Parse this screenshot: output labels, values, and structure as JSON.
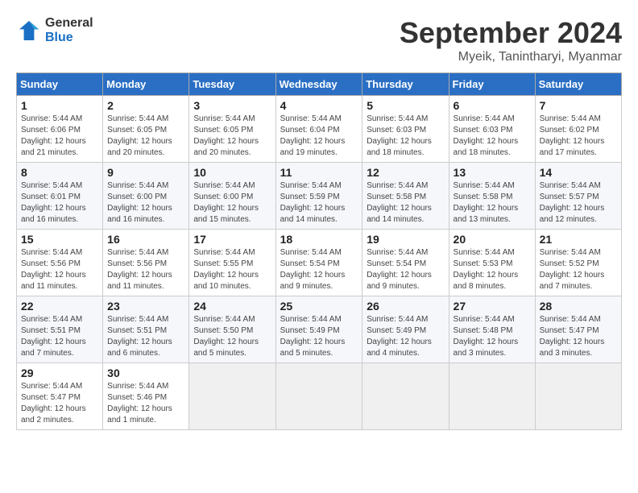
{
  "logo": {
    "line1": "General",
    "line2": "Blue"
  },
  "title": "September 2024",
  "location": "Myeik, Tanintharyi, Myanmar",
  "headers": [
    "Sunday",
    "Monday",
    "Tuesday",
    "Wednesday",
    "Thursday",
    "Friday",
    "Saturday"
  ],
  "weeks": [
    [
      {
        "day": "1",
        "info": "Sunrise: 5:44 AM\nSunset: 6:06 PM\nDaylight: 12 hours\nand 21 minutes."
      },
      {
        "day": "2",
        "info": "Sunrise: 5:44 AM\nSunset: 6:05 PM\nDaylight: 12 hours\nand 20 minutes."
      },
      {
        "day": "3",
        "info": "Sunrise: 5:44 AM\nSunset: 6:05 PM\nDaylight: 12 hours\nand 20 minutes."
      },
      {
        "day": "4",
        "info": "Sunrise: 5:44 AM\nSunset: 6:04 PM\nDaylight: 12 hours\nand 19 minutes."
      },
      {
        "day": "5",
        "info": "Sunrise: 5:44 AM\nSunset: 6:03 PM\nDaylight: 12 hours\nand 18 minutes."
      },
      {
        "day": "6",
        "info": "Sunrise: 5:44 AM\nSunset: 6:03 PM\nDaylight: 12 hours\nand 18 minutes."
      },
      {
        "day": "7",
        "info": "Sunrise: 5:44 AM\nSunset: 6:02 PM\nDaylight: 12 hours\nand 17 minutes."
      }
    ],
    [
      {
        "day": "8",
        "info": "Sunrise: 5:44 AM\nSunset: 6:01 PM\nDaylight: 12 hours\nand 16 minutes."
      },
      {
        "day": "9",
        "info": "Sunrise: 5:44 AM\nSunset: 6:00 PM\nDaylight: 12 hours\nand 16 minutes."
      },
      {
        "day": "10",
        "info": "Sunrise: 5:44 AM\nSunset: 6:00 PM\nDaylight: 12 hours\nand 15 minutes."
      },
      {
        "day": "11",
        "info": "Sunrise: 5:44 AM\nSunset: 5:59 PM\nDaylight: 12 hours\nand 14 minutes."
      },
      {
        "day": "12",
        "info": "Sunrise: 5:44 AM\nSunset: 5:58 PM\nDaylight: 12 hours\nand 14 minutes."
      },
      {
        "day": "13",
        "info": "Sunrise: 5:44 AM\nSunset: 5:58 PM\nDaylight: 12 hours\nand 13 minutes."
      },
      {
        "day": "14",
        "info": "Sunrise: 5:44 AM\nSunset: 5:57 PM\nDaylight: 12 hours\nand 12 minutes."
      }
    ],
    [
      {
        "day": "15",
        "info": "Sunrise: 5:44 AM\nSunset: 5:56 PM\nDaylight: 12 hours\nand 11 minutes."
      },
      {
        "day": "16",
        "info": "Sunrise: 5:44 AM\nSunset: 5:56 PM\nDaylight: 12 hours\nand 11 minutes."
      },
      {
        "day": "17",
        "info": "Sunrise: 5:44 AM\nSunset: 5:55 PM\nDaylight: 12 hours\nand 10 minutes."
      },
      {
        "day": "18",
        "info": "Sunrise: 5:44 AM\nSunset: 5:54 PM\nDaylight: 12 hours\nand 9 minutes."
      },
      {
        "day": "19",
        "info": "Sunrise: 5:44 AM\nSunset: 5:54 PM\nDaylight: 12 hours\nand 9 minutes."
      },
      {
        "day": "20",
        "info": "Sunrise: 5:44 AM\nSunset: 5:53 PM\nDaylight: 12 hours\nand 8 minutes."
      },
      {
        "day": "21",
        "info": "Sunrise: 5:44 AM\nSunset: 5:52 PM\nDaylight: 12 hours\nand 7 minutes."
      }
    ],
    [
      {
        "day": "22",
        "info": "Sunrise: 5:44 AM\nSunset: 5:51 PM\nDaylight: 12 hours\nand 7 minutes."
      },
      {
        "day": "23",
        "info": "Sunrise: 5:44 AM\nSunset: 5:51 PM\nDaylight: 12 hours\nand 6 minutes."
      },
      {
        "day": "24",
        "info": "Sunrise: 5:44 AM\nSunset: 5:50 PM\nDaylight: 12 hours\nand 5 minutes."
      },
      {
        "day": "25",
        "info": "Sunrise: 5:44 AM\nSunset: 5:49 PM\nDaylight: 12 hours\nand 5 minutes."
      },
      {
        "day": "26",
        "info": "Sunrise: 5:44 AM\nSunset: 5:49 PM\nDaylight: 12 hours\nand 4 minutes."
      },
      {
        "day": "27",
        "info": "Sunrise: 5:44 AM\nSunset: 5:48 PM\nDaylight: 12 hours\nand 3 minutes."
      },
      {
        "day": "28",
        "info": "Sunrise: 5:44 AM\nSunset: 5:47 PM\nDaylight: 12 hours\nand 3 minutes."
      }
    ],
    [
      {
        "day": "29",
        "info": "Sunrise: 5:44 AM\nSunset: 5:47 PM\nDaylight: 12 hours\nand 2 minutes."
      },
      {
        "day": "30",
        "info": "Sunrise: 5:44 AM\nSunset: 5:46 PM\nDaylight: 12 hours\nand 1 minute."
      },
      null,
      null,
      null,
      null,
      null
    ]
  ]
}
